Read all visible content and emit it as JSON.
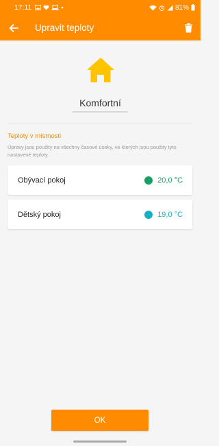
{
  "status_bar": {
    "time": "17:11",
    "battery": "81%"
  },
  "app_bar": {
    "title": "Upravit teploty",
    "icons": [
      "back-arrow-icon",
      "trash-icon"
    ]
  },
  "mode": {
    "icon": "house-icon",
    "name": "Komfortní"
  },
  "section": {
    "title": "Teploty v místnosti",
    "description": "Úpravy jsou použity na všechny časové úseky, ve kterých jsou použity tyto nastavené teploty."
  },
  "rooms": [
    {
      "name": "Obývací pokoj",
      "temp": "20,0 °C",
      "color": "#17a064"
    },
    {
      "name": "Dětský pokoj",
      "temp": "19,0 °C",
      "color": "#17b0c2"
    }
  ],
  "ok_button": {
    "label": "OK"
  },
  "colors": {
    "accent": "#ff8c00",
    "section_title": "#f08a00",
    "house_icon": "#ffc400"
  }
}
